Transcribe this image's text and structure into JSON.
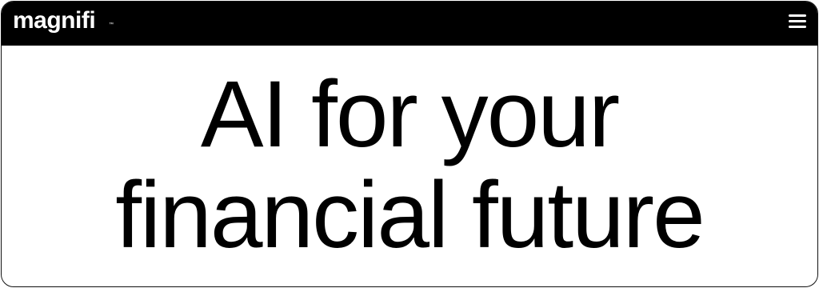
{
  "header": {
    "logo_text": "magnifi",
    "trademark": "™",
    "menu_icon": "hamburger-menu-icon",
    "background": "#000000",
    "foreground": "#ffffff"
  },
  "hero": {
    "line1": "AI for your",
    "line2": "financial future",
    "text_color": "#000000"
  }
}
